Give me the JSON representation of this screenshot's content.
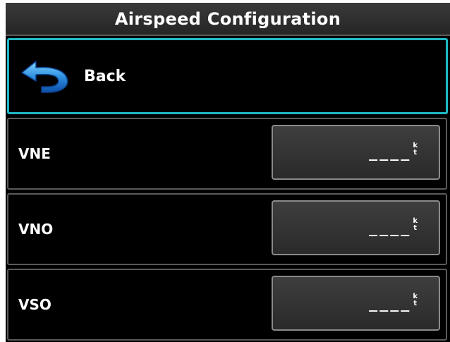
{
  "header": {
    "title": "Airspeed Configuration"
  },
  "back": {
    "label": "Back",
    "icon": "back-arrow-icon",
    "accent_color": "#1fb8c4"
  },
  "rows": [
    {
      "label": "VNE",
      "value": "____",
      "unit_top": "k",
      "unit_bottom": "t"
    },
    {
      "label": "VNO",
      "value": "____",
      "unit_top": "k",
      "unit_bottom": "t"
    },
    {
      "label": "VSO",
      "value": "____",
      "unit_top": "k",
      "unit_bottom": "t"
    }
  ]
}
